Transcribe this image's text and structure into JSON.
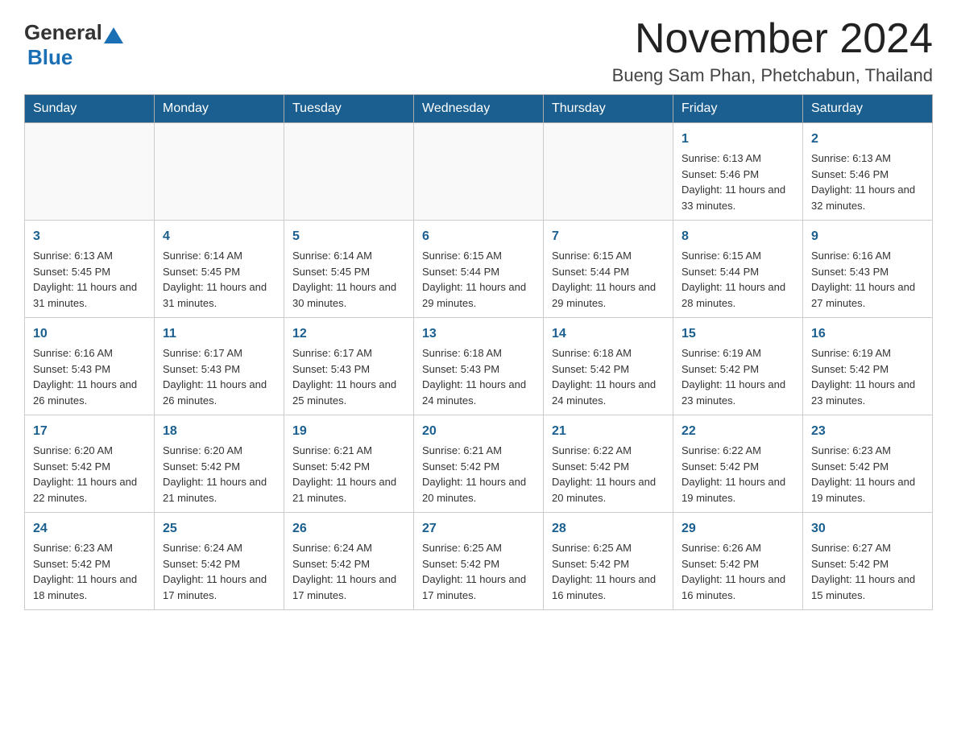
{
  "header": {
    "logo_general": "General",
    "logo_blue": "Blue",
    "month_title": "November 2024",
    "subtitle": "Bueng Sam Phan, Phetchabun, Thailand"
  },
  "weekdays": [
    "Sunday",
    "Monday",
    "Tuesday",
    "Wednesday",
    "Thursday",
    "Friday",
    "Saturday"
  ],
  "weeks": [
    [
      {
        "day": "",
        "info": ""
      },
      {
        "day": "",
        "info": ""
      },
      {
        "day": "",
        "info": ""
      },
      {
        "day": "",
        "info": ""
      },
      {
        "day": "",
        "info": ""
      },
      {
        "day": "1",
        "info": "Sunrise: 6:13 AM\nSunset: 5:46 PM\nDaylight: 11 hours and 33 minutes."
      },
      {
        "day": "2",
        "info": "Sunrise: 6:13 AM\nSunset: 5:46 PM\nDaylight: 11 hours and 32 minutes."
      }
    ],
    [
      {
        "day": "3",
        "info": "Sunrise: 6:13 AM\nSunset: 5:45 PM\nDaylight: 11 hours and 31 minutes."
      },
      {
        "day": "4",
        "info": "Sunrise: 6:14 AM\nSunset: 5:45 PM\nDaylight: 11 hours and 31 minutes."
      },
      {
        "day": "5",
        "info": "Sunrise: 6:14 AM\nSunset: 5:45 PM\nDaylight: 11 hours and 30 minutes."
      },
      {
        "day": "6",
        "info": "Sunrise: 6:15 AM\nSunset: 5:44 PM\nDaylight: 11 hours and 29 minutes."
      },
      {
        "day": "7",
        "info": "Sunrise: 6:15 AM\nSunset: 5:44 PM\nDaylight: 11 hours and 29 minutes."
      },
      {
        "day": "8",
        "info": "Sunrise: 6:15 AM\nSunset: 5:44 PM\nDaylight: 11 hours and 28 minutes."
      },
      {
        "day": "9",
        "info": "Sunrise: 6:16 AM\nSunset: 5:43 PM\nDaylight: 11 hours and 27 minutes."
      }
    ],
    [
      {
        "day": "10",
        "info": "Sunrise: 6:16 AM\nSunset: 5:43 PM\nDaylight: 11 hours and 26 minutes."
      },
      {
        "day": "11",
        "info": "Sunrise: 6:17 AM\nSunset: 5:43 PM\nDaylight: 11 hours and 26 minutes."
      },
      {
        "day": "12",
        "info": "Sunrise: 6:17 AM\nSunset: 5:43 PM\nDaylight: 11 hours and 25 minutes."
      },
      {
        "day": "13",
        "info": "Sunrise: 6:18 AM\nSunset: 5:43 PM\nDaylight: 11 hours and 24 minutes."
      },
      {
        "day": "14",
        "info": "Sunrise: 6:18 AM\nSunset: 5:42 PM\nDaylight: 11 hours and 24 minutes."
      },
      {
        "day": "15",
        "info": "Sunrise: 6:19 AM\nSunset: 5:42 PM\nDaylight: 11 hours and 23 minutes."
      },
      {
        "day": "16",
        "info": "Sunrise: 6:19 AM\nSunset: 5:42 PM\nDaylight: 11 hours and 23 minutes."
      }
    ],
    [
      {
        "day": "17",
        "info": "Sunrise: 6:20 AM\nSunset: 5:42 PM\nDaylight: 11 hours and 22 minutes."
      },
      {
        "day": "18",
        "info": "Sunrise: 6:20 AM\nSunset: 5:42 PM\nDaylight: 11 hours and 21 minutes."
      },
      {
        "day": "19",
        "info": "Sunrise: 6:21 AM\nSunset: 5:42 PM\nDaylight: 11 hours and 21 minutes."
      },
      {
        "day": "20",
        "info": "Sunrise: 6:21 AM\nSunset: 5:42 PM\nDaylight: 11 hours and 20 minutes."
      },
      {
        "day": "21",
        "info": "Sunrise: 6:22 AM\nSunset: 5:42 PM\nDaylight: 11 hours and 20 minutes."
      },
      {
        "day": "22",
        "info": "Sunrise: 6:22 AM\nSunset: 5:42 PM\nDaylight: 11 hours and 19 minutes."
      },
      {
        "day": "23",
        "info": "Sunrise: 6:23 AM\nSunset: 5:42 PM\nDaylight: 11 hours and 19 minutes."
      }
    ],
    [
      {
        "day": "24",
        "info": "Sunrise: 6:23 AM\nSunset: 5:42 PM\nDaylight: 11 hours and 18 minutes."
      },
      {
        "day": "25",
        "info": "Sunrise: 6:24 AM\nSunset: 5:42 PM\nDaylight: 11 hours and 17 minutes."
      },
      {
        "day": "26",
        "info": "Sunrise: 6:24 AM\nSunset: 5:42 PM\nDaylight: 11 hours and 17 minutes."
      },
      {
        "day": "27",
        "info": "Sunrise: 6:25 AM\nSunset: 5:42 PM\nDaylight: 11 hours and 17 minutes."
      },
      {
        "day": "28",
        "info": "Sunrise: 6:25 AM\nSunset: 5:42 PM\nDaylight: 11 hours and 16 minutes."
      },
      {
        "day": "29",
        "info": "Sunrise: 6:26 AM\nSunset: 5:42 PM\nDaylight: 11 hours and 16 minutes."
      },
      {
        "day": "30",
        "info": "Sunrise: 6:27 AM\nSunset: 5:42 PM\nDaylight: 11 hours and 15 minutes."
      }
    ]
  ]
}
